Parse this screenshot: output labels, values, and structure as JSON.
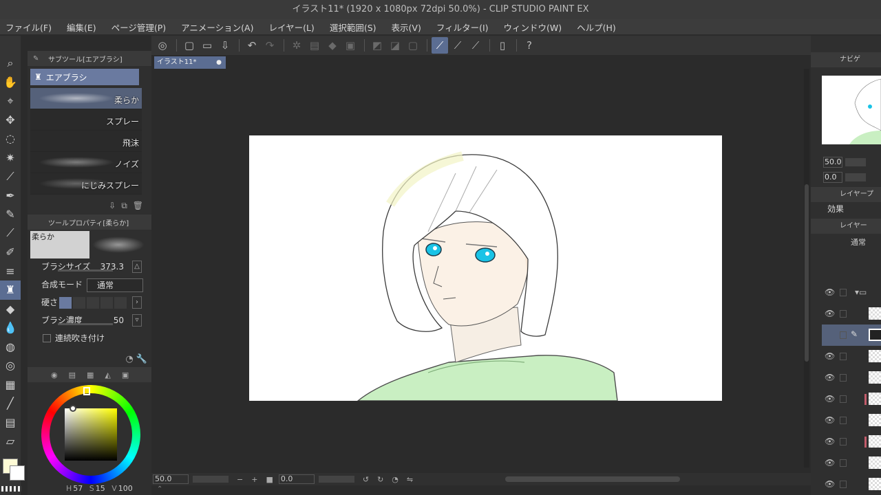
{
  "window": {
    "title": "イラスト11* (1920 x 1080px 72dpi 50.0%) - CLIP STUDIO PAINT EX"
  },
  "menu": [
    "ファイル(F)",
    "編集(E)",
    "ページ管理(P)",
    "アニメーション(A)",
    "レイヤー(L)",
    "選択範囲(S)",
    "表示(V)",
    "フィルター(I)",
    "ウィンドウ(W)",
    "ヘルプ(H)"
  ],
  "subtool": {
    "header": "サブツール[エアブラシ]",
    "group": "エアブラシ",
    "brushes": [
      "柔らか",
      "スプレー",
      "飛沫",
      "ノイズ",
      "にじみスプレー"
    ],
    "selected_index": 0
  },
  "tool_property": {
    "header": "ツールプロパティ[柔らか]",
    "preview_label": "柔らか",
    "brush_size": {
      "label": "ブラシサイズ",
      "value": "373.3"
    },
    "blend_mode": {
      "label": "合成モード",
      "value": "通常"
    },
    "hardness": {
      "label": "硬さ",
      "level": 1,
      "steps": 5
    },
    "density": {
      "label": "ブラシ濃度",
      "value": "50"
    },
    "continuous": {
      "label": "連続吹き付け",
      "checked": false
    }
  },
  "color": {
    "main": "#fffbd6",
    "sub": "#ffffff",
    "h_label": "H",
    "h": "57",
    "s_label": "S",
    "s": "15",
    "v_label": "V",
    "v": "100"
  },
  "document": {
    "tab": "イラスト11*"
  },
  "status": {
    "zoom": "50.0",
    "rotation": "0.0",
    "minus": "−",
    "plus": "+"
  },
  "navigator": {
    "header": "ナビゲ",
    "zoom": "50.0",
    "rotation": "0.0"
  },
  "layer_property": {
    "header": "レイヤープ",
    "effect_label": "効果"
  },
  "layers": {
    "header": "レイヤー",
    "blend": "通常"
  }
}
